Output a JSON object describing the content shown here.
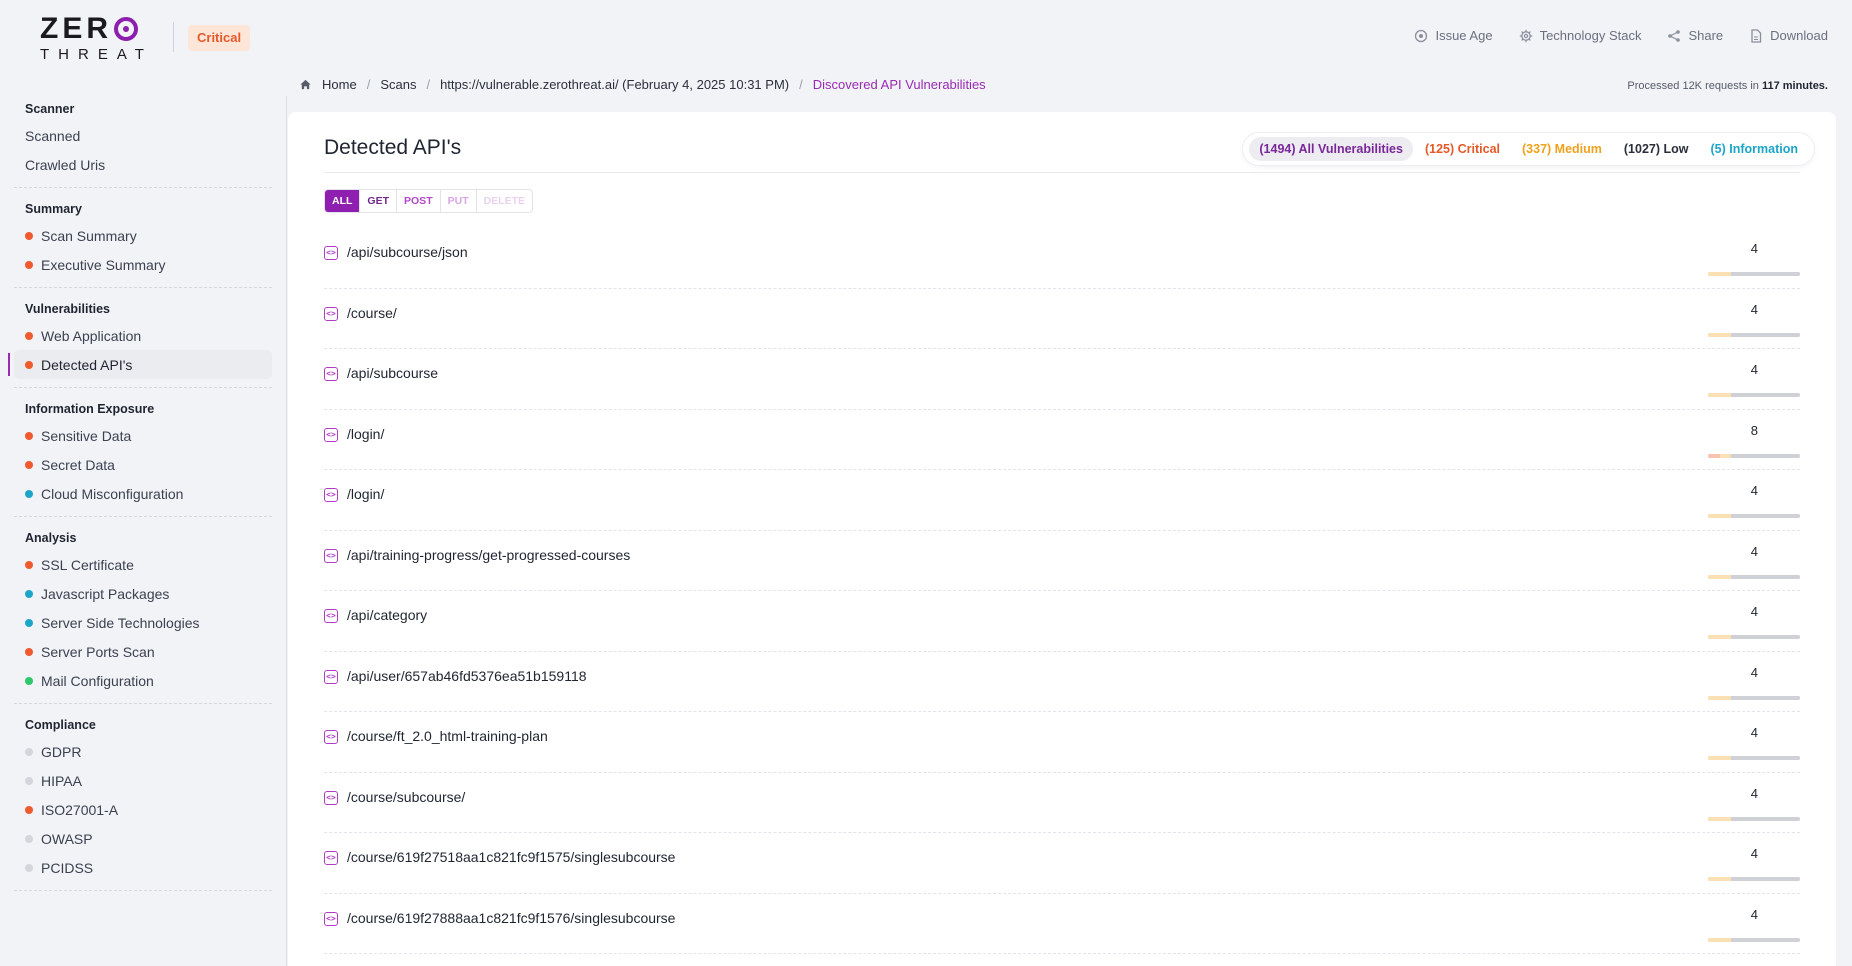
{
  "brand": {
    "logo_top": "ZER",
    "logo_bottom": "THREAT",
    "severity_badge": "Critical"
  },
  "top_actions": [
    {
      "label": "Issue Age",
      "icon": "target-icon"
    },
    {
      "label": "Technology Stack",
      "icon": "gear-icon"
    },
    {
      "label": "Share",
      "icon": "share-icon"
    },
    {
      "label": "Download",
      "icon": "file-icon"
    }
  ],
  "breadcrumb": {
    "home": "Home",
    "scans": "Scans",
    "target": "https://vulnerable.zerothreat.ai/ (February 4, 2025 10:31 PM)",
    "current": "Discovered API Vulnerabilities"
  },
  "processed": {
    "prefix": "Processed 12K requests in",
    "duration": "117 minutes."
  },
  "sidebar": {
    "groups": [
      {
        "title": "Scanner",
        "items": [
          {
            "label": "Scanned",
            "dot": ""
          },
          {
            "label": "Crawled Uris",
            "dot": ""
          }
        ]
      },
      {
        "title": "Summary",
        "items": [
          {
            "label": "Scan Summary",
            "dot": "#ef5a2f"
          },
          {
            "label": "Executive Summary",
            "dot": "#ef5a2f"
          }
        ]
      },
      {
        "title": "Vulnerabilities",
        "items": [
          {
            "label": "Web Application",
            "dot": "#ef5a2f"
          },
          {
            "label": "Detected API's",
            "dot": "#ef5a2f",
            "active": true
          }
        ]
      },
      {
        "title": "Information Exposure",
        "items": [
          {
            "label": "Sensitive Data",
            "dot": "#ef5a2f"
          },
          {
            "label": "Secret Data",
            "dot": "#ef5a2f"
          },
          {
            "label": "Cloud Misconfiguration",
            "dot": "#1da5c9"
          }
        ]
      },
      {
        "title": "Analysis",
        "items": [
          {
            "label": "SSL Certificate",
            "dot": "#ef5a2f"
          },
          {
            "label": "Javascript Packages",
            "dot": "#1da5c9"
          },
          {
            "label": "Server Side Technologies",
            "dot": "#1da5c9"
          },
          {
            "label": "Server Ports Scan",
            "dot": "#ef5a2f"
          },
          {
            "label": "Mail Configuration",
            "dot": "#2ec76b"
          }
        ]
      },
      {
        "title": "Compliance",
        "items": [
          {
            "label": "GDPR",
            "dot": "#d4d6db"
          },
          {
            "label": "HIPAA",
            "dot": "#d4d6db"
          },
          {
            "label": "ISO27001-A",
            "dot": "#ef5a2f"
          },
          {
            "label": "OWASP",
            "dot": "#d4d6db"
          },
          {
            "label": "PCIDSS",
            "dot": "#d4d6db"
          }
        ]
      }
    ]
  },
  "main": {
    "title": "Detected API's",
    "filters": {
      "all": "(1494) All Vulnerabilities",
      "critical": "(125) Critical",
      "medium": "(337) Medium",
      "low": "(1027) Low",
      "info": "(5) Information"
    },
    "methods": [
      "ALL",
      "GET",
      "POST",
      "PUT",
      "DELETE"
    ],
    "apis": [
      {
        "path": "/api/subcourse/json",
        "count": "4",
        "critical": 0,
        "medium": 1,
        "low": 3
      },
      {
        "path": "/course/",
        "count": "4",
        "critical": 0,
        "medium": 1,
        "low": 3
      },
      {
        "path": "/api/subcourse",
        "count": "4",
        "critical": 0,
        "medium": 1,
        "low": 3
      },
      {
        "path": "/login/",
        "count": "8",
        "critical": 1,
        "medium": 1,
        "low": 6
      },
      {
        "path": "/login/",
        "count": "4",
        "critical": 0,
        "medium": 1,
        "low": 3
      },
      {
        "path": "/api/training-progress/get-progressed-courses",
        "count": "4",
        "critical": 0,
        "medium": 1,
        "low": 3
      },
      {
        "path": "/api/category",
        "count": "4",
        "critical": 0,
        "medium": 1,
        "low": 3
      },
      {
        "path": "/api/user/657ab46fd5376ea51b159118",
        "count": "4",
        "critical": 0,
        "medium": 1,
        "low": 3
      },
      {
        "path": "/course/ft_2.0_html-training-plan",
        "count": "4",
        "critical": 0,
        "medium": 1,
        "low": 3
      },
      {
        "path": "/course/subcourse/",
        "count": "4",
        "critical": 0,
        "medium": 1,
        "low": 3
      },
      {
        "path": "/course/619f27518aa1c821fc9f1575/singlesubcourse",
        "count": "4",
        "critical": 0,
        "medium": 1,
        "low": 3
      },
      {
        "path": "/course/619f27888aa1c821fc9f1576/singlesubcourse",
        "count": "4",
        "critical": 0,
        "medium": 1,
        "low": 3
      }
    ]
  }
}
